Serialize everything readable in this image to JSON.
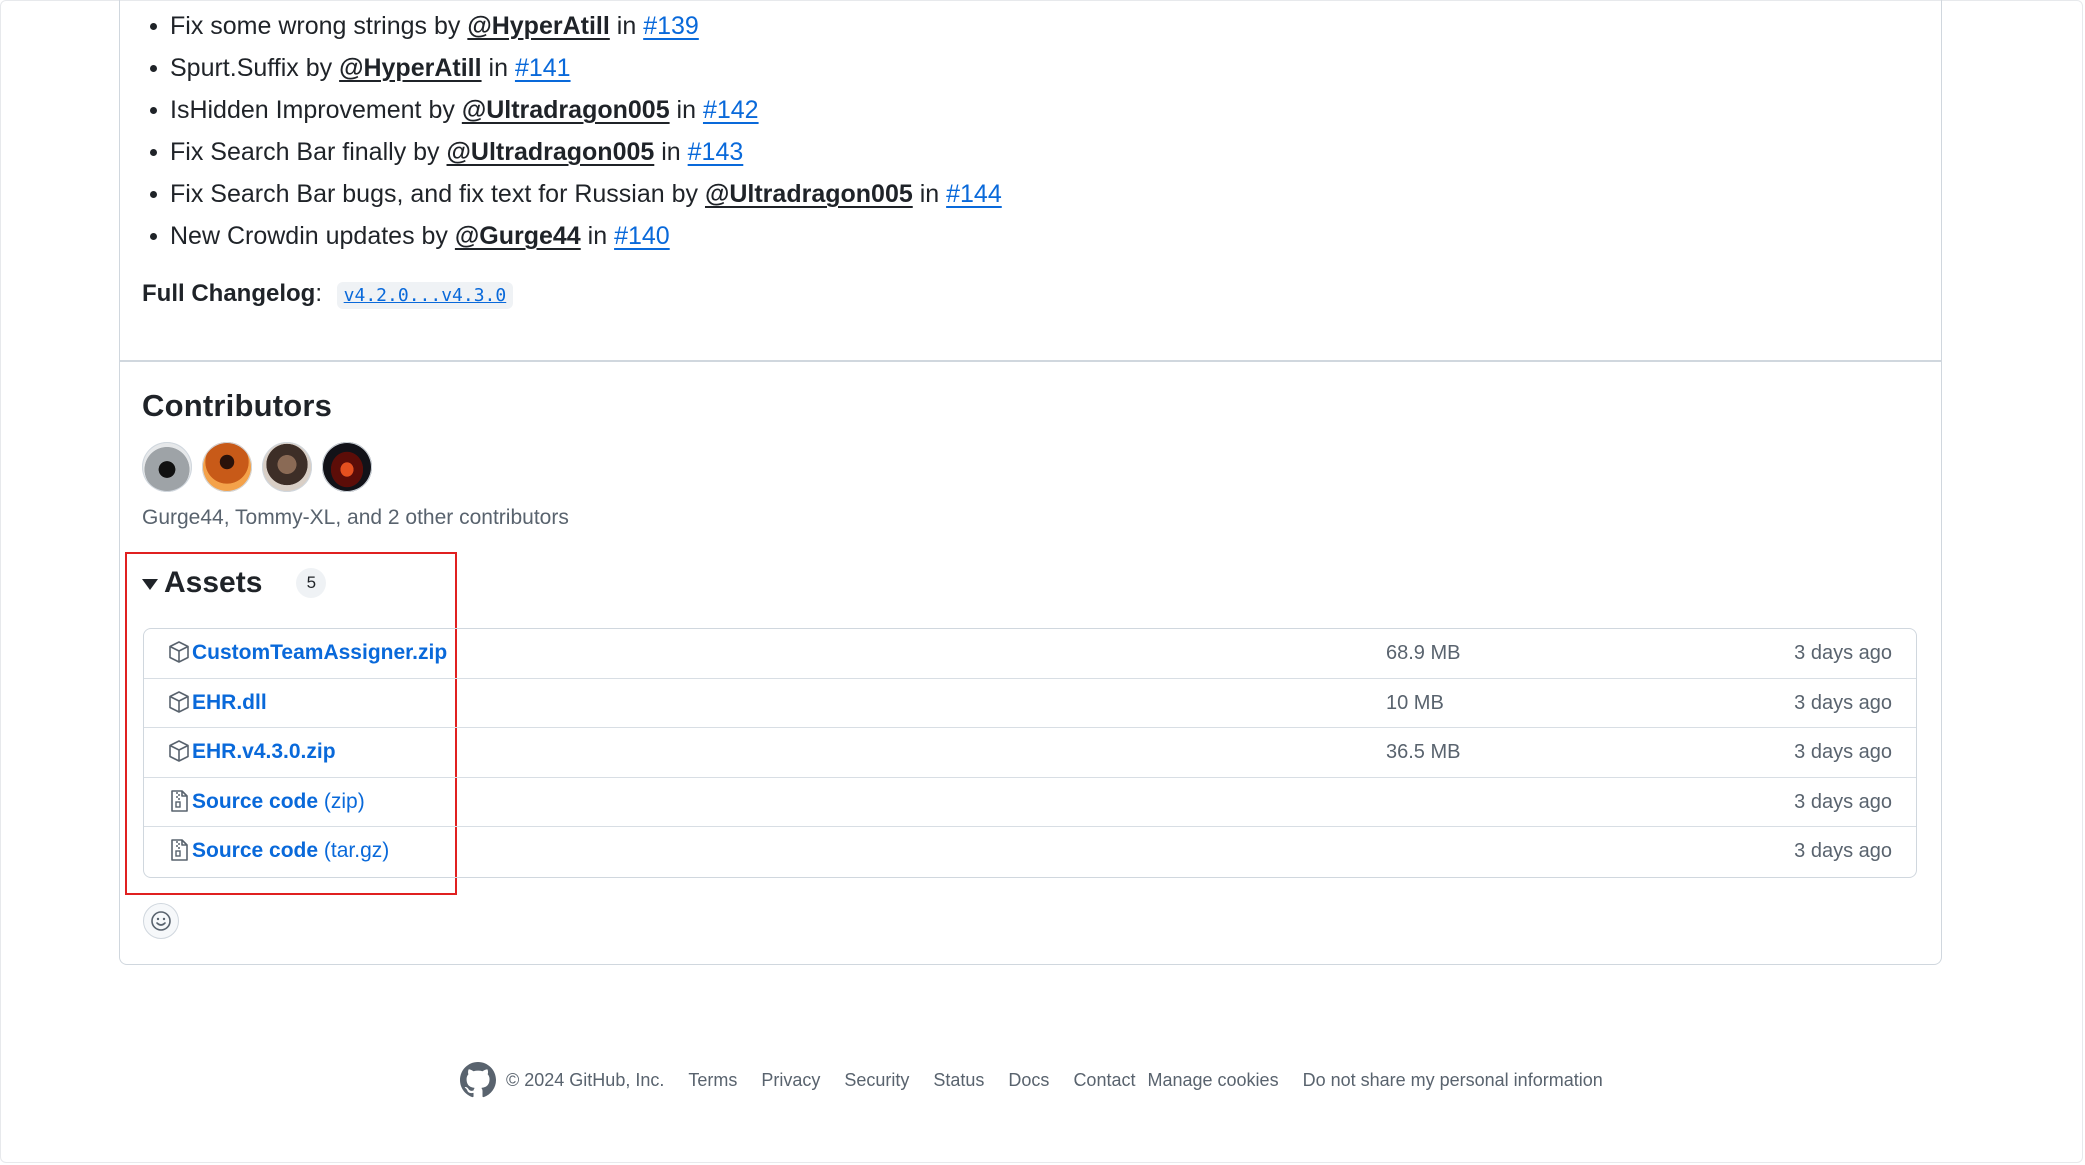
{
  "changes": [
    {
      "text": "Fix some wrong strings",
      "by": "by",
      "user": "@HyperAtill",
      "in": "in",
      "pr": "#139"
    },
    {
      "text": "Spurt.Suffix",
      "by": "by",
      "user": "@HyperAtill",
      "in": "in",
      "pr": "#141"
    },
    {
      "text": "IsHidden Improvement",
      "by": "by",
      "user": "@Ultradragon005",
      "in": "in",
      "pr": "#142"
    },
    {
      "text": "Fix Search Bar finally",
      "by": "by",
      "user": "@Ultradragon005",
      "in": "in",
      "pr": "#143"
    },
    {
      "text": "Fix Search Bar bugs, and fix text for Russian",
      "by": "by",
      "user": "@Ultradragon005",
      "in": "in",
      "pr": "#144"
    },
    {
      "text": "New Crowdin updates",
      "by": "by",
      "user": "@Gurge44",
      "in": "in",
      "pr": "#140"
    }
  ],
  "full_changelog": {
    "label": "Full Changelog",
    "colon": ":",
    "link": "v4.2.0...v4.3.0"
  },
  "contributors": {
    "title": "Contributors",
    "summary": "Gurge44, Tommy-XL, and 2 other contributors"
  },
  "assets": {
    "title": "Assets",
    "count": "5",
    "rows": [
      {
        "icon": "package-icon",
        "name": "CustomTeamAssigner.zip",
        "suffix": "",
        "size": "68.9 MB",
        "date": "3 days ago"
      },
      {
        "icon": "package-icon",
        "name": "EHR.dll",
        "suffix": "",
        "size": "10 MB",
        "date": "3 days ago"
      },
      {
        "icon": "package-icon",
        "name": "EHR.v4.3.0.zip",
        "suffix": "",
        "size": "36.5 MB",
        "date": "3 days ago"
      },
      {
        "icon": "file-zip-icon",
        "name": "Source code",
        "suffix": "(zip)",
        "size": "",
        "date": "3 days ago"
      },
      {
        "icon": "file-zip-icon",
        "name": "Source code",
        "suffix": "(tar.gz)",
        "size": "",
        "date": "3 days ago"
      }
    ]
  },
  "footer": {
    "copyright": "© 2024 GitHub, Inc.",
    "links": [
      "Terms",
      "Privacy",
      "Security",
      "Status",
      "Docs",
      "Contact",
      "Manage cookies",
      "Do not share my personal information"
    ]
  },
  "colors": {
    "link": "#0969da",
    "border": "#d0d7de",
    "highlight": "#e02020",
    "muted": "#59636e"
  }
}
